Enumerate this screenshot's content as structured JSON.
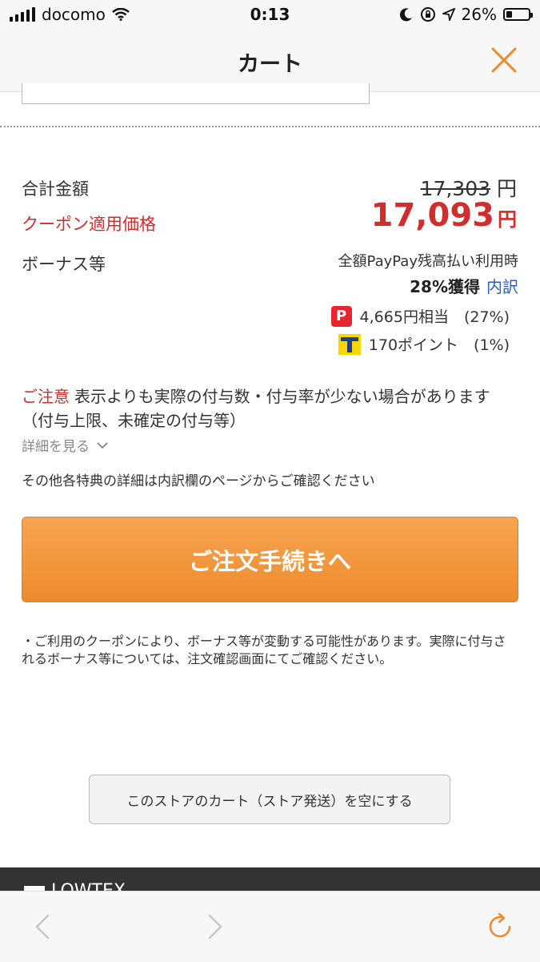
{
  "status": {
    "carrier": "docomo",
    "time": "0:13",
    "battery": "26%",
    "battery_level": 0.26
  },
  "header": {
    "title": "カート"
  },
  "totals": {
    "total_label": "合計金額",
    "original_price": "17,303",
    "yen": "円",
    "coupon_label": "クーポン適用価格",
    "coupon_price": "17,093"
  },
  "bonus": {
    "label": "ボーナス等",
    "condition": "全額PayPay残高払い利用時",
    "rate": "28%獲得",
    "breakdown_link": "内訳",
    "paypay_line": "4,665円相当　(27%)",
    "tpoint_line": "170ポイント　(1%)"
  },
  "notice": {
    "head": "ご注意",
    "text": "表示よりも実際の付与数・付与率が少ない場合があります（付与上限、未確定の付与等）",
    "details_link": "詳細を見る",
    "other": "その他各特典の詳細は内訳欄のページからご確認ください"
  },
  "order_button": {
    "label": "ご注文手続きへ"
  },
  "note": "・ご利用のクーポンにより、ボーナス等が変動する可能性があります。実際に付与されるボーナス等については、注文確認画面にてご確認ください。",
  "clear_button": {
    "label": "このストアのカート（ストア発送）を空にする"
  },
  "footer": {
    "logo": "LOWTEX"
  },
  "colors": {
    "accent_orange": "#ee8a2c",
    "sale_red": "#d12d2d",
    "link_blue": "#2c5fb8"
  },
  "icons": [
    "signal-icon",
    "wifi-icon",
    "moon-icon",
    "rotation-lock-icon",
    "location-icon",
    "battery-icon",
    "close-icon",
    "paypay-icon",
    "tpoint-icon",
    "chevron-down-icon",
    "back-icon",
    "forward-icon",
    "reload-icon"
  ]
}
